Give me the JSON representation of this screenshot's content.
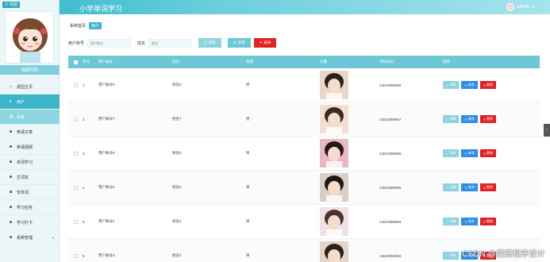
{
  "header": {
    "title": "小学单词学习",
    "user": "admin"
  },
  "sidebar": {
    "back_label": "≪ 收起",
    "username": "admin",
    "items": [
      {
        "label": "返回主页",
        "icon": "home-icon"
      },
      {
        "label": "用户",
        "icon": "user-icon"
      },
      {
        "label": "年级",
        "icon": "grade-icon"
      },
      {
        "label": "英语文章",
        "icon": "article-icon"
      },
      {
        "label": "英语视频",
        "icon": "video-icon"
      },
      {
        "label": "单词学习",
        "icon": "book-icon"
      },
      {
        "label": "生词本",
        "icon": "notebook-icon"
      },
      {
        "label": "背单词",
        "icon": "memorize-icon"
      },
      {
        "label": "学习任务",
        "icon": "task-icon"
      },
      {
        "label": "学习打卡",
        "icon": "checkin-icon"
      },
      {
        "label": "系统管理",
        "icon": "settings-icon"
      }
    ]
  },
  "breadcrumb": {
    "home": "系统首页",
    "current": "用户"
  },
  "filter": {
    "account_label": "用户账号",
    "account_placeholder": "用户账号",
    "name_label": "姓名",
    "name_placeholder": "姓名",
    "search_btn": "搜索",
    "add_btn": "新增",
    "delete_btn": "删除"
  },
  "table": {
    "headers": [
      "",
      "序号",
      "用户账号",
      "姓名",
      "性别",
      "头像",
      "手机号码",
      "操作"
    ],
    "actions": {
      "detail": "详情",
      "edit": "修改",
      "delete": "删除"
    },
    "rows": [
      {
        "idx": "1",
        "account": "用户账号8",
        "name": "姓名8",
        "gender": "男",
        "phone": "13823888888"
      },
      {
        "idx": "2",
        "account": "用户账号7",
        "name": "姓名7",
        "gender": "男",
        "phone": "13823888887"
      },
      {
        "idx": "3",
        "account": "用户账号6",
        "name": "姓名6",
        "gender": "男",
        "phone": "13823888886"
      },
      {
        "idx": "4",
        "account": "用户账号5",
        "name": "姓名5",
        "gender": "男",
        "phone": "13823888885"
      },
      {
        "idx": "5",
        "account": "用户账号4",
        "name": "姓名4",
        "gender": "男",
        "phone": "13823888884"
      },
      {
        "idx": "6",
        "account": "用户账号3",
        "name": "姓名3",
        "gender": "男",
        "phone": "13823888883"
      }
    ]
  },
  "watermark": "CSDN @便捷程序设计",
  "colors": {
    "accent": "#3db5c8",
    "edit": "#2d8fe8",
    "delete": "#e32222"
  }
}
